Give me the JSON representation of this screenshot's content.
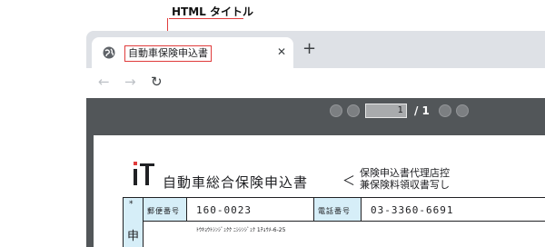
{
  "annotation": {
    "label": "HTML タイトル",
    "accent_color": "#e03c3c"
  },
  "browser": {
    "tab": {
      "favicon": "globe-icon",
      "title": "自動車保険申込書",
      "close_glyph": "✕"
    },
    "new_tab_glyph": "+",
    "nav": {
      "back_glyph": "←",
      "forward_glyph": "→",
      "reload_glyph": "↻"
    }
  },
  "pdf_viewer": {
    "toolbar_color": "#525659",
    "buttons": [
      "first-page-icon",
      "previous-page-icon",
      "next-page-icon"
    ],
    "current_page": "1",
    "total_pages": "/ 1"
  },
  "document": {
    "logo": "iT",
    "title": "自動車総合保険申込書",
    "bracket": "＜",
    "note_line1": "保険申込書代理店控",
    "note_line2": "兼保険料領収書写し",
    "form": {
      "side_star": "*",
      "side_char": "申",
      "postal_label": "郵便番号",
      "postal_value": "160-0023",
      "phone_label": "電話番号",
      "phone_value": "03-3360-6691",
      "address_kana": "ﾄｳｷｮｳﾄｼﾝｼﾞｭｸｸ ﾆｼｼﾝｼﾞｭｸ 1ﾁｮｳﾒ-6-25"
    }
  }
}
